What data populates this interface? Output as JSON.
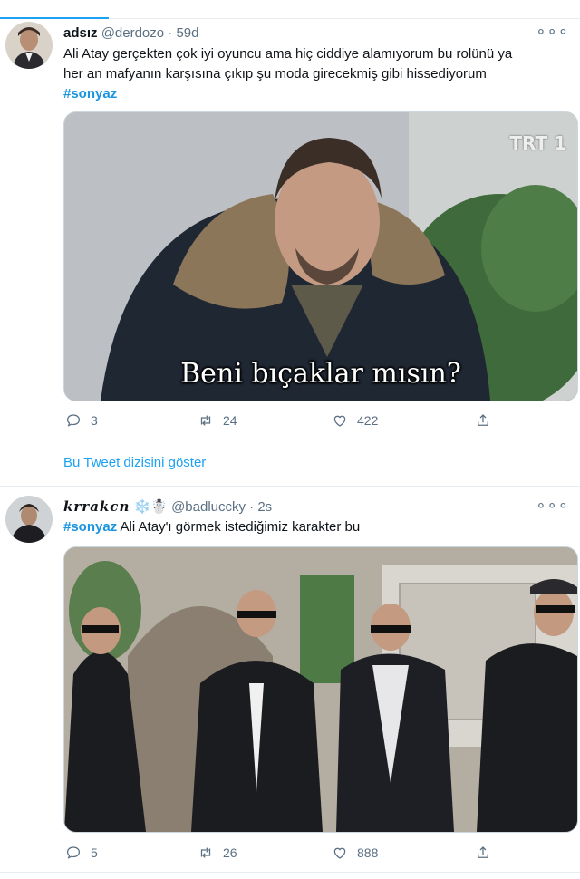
{
  "tweets": [
    {
      "display_name": "adsız",
      "handle": "@derdozo",
      "time": "· 59d",
      "text_line1": "Ali Atay gerçekten çok iyi oyuncu ama hiç ciddiye alamıyorum bu rolünü ya",
      "text_line2": "her an mafyanın karşısına çıkıp şu moda girecekmiş gibi hissediyorum",
      "hashtag": "#sonyaz",
      "media": {
        "caption": "Beni bıçaklar mısın?",
        "watermark": "TRT 1"
      },
      "replies": "3",
      "retweets": "24",
      "likes": "422",
      "thread_link": "Bu Tweet dizisini göster"
    },
    {
      "display_name": "krrakcn",
      "name_emojis": "❄️☃️",
      "handle": "@badluccky",
      "time": "· 2s",
      "hashtag": "#sonyaz",
      "text": "Ali Atay'ı görmek istediğimiz karakter bu",
      "replies": "5",
      "retweets": "26",
      "likes": "888"
    }
  ],
  "icons": {
    "reply": "reply-icon",
    "retweet": "retweet-icon",
    "like": "heart-icon",
    "share": "share-icon",
    "more": "more-icon"
  },
  "colors": {
    "accent": "#1da1f2",
    "hashtag": "#1b95e0",
    "secondary_text": "#5b7083",
    "border": "#e6ecf0"
  }
}
